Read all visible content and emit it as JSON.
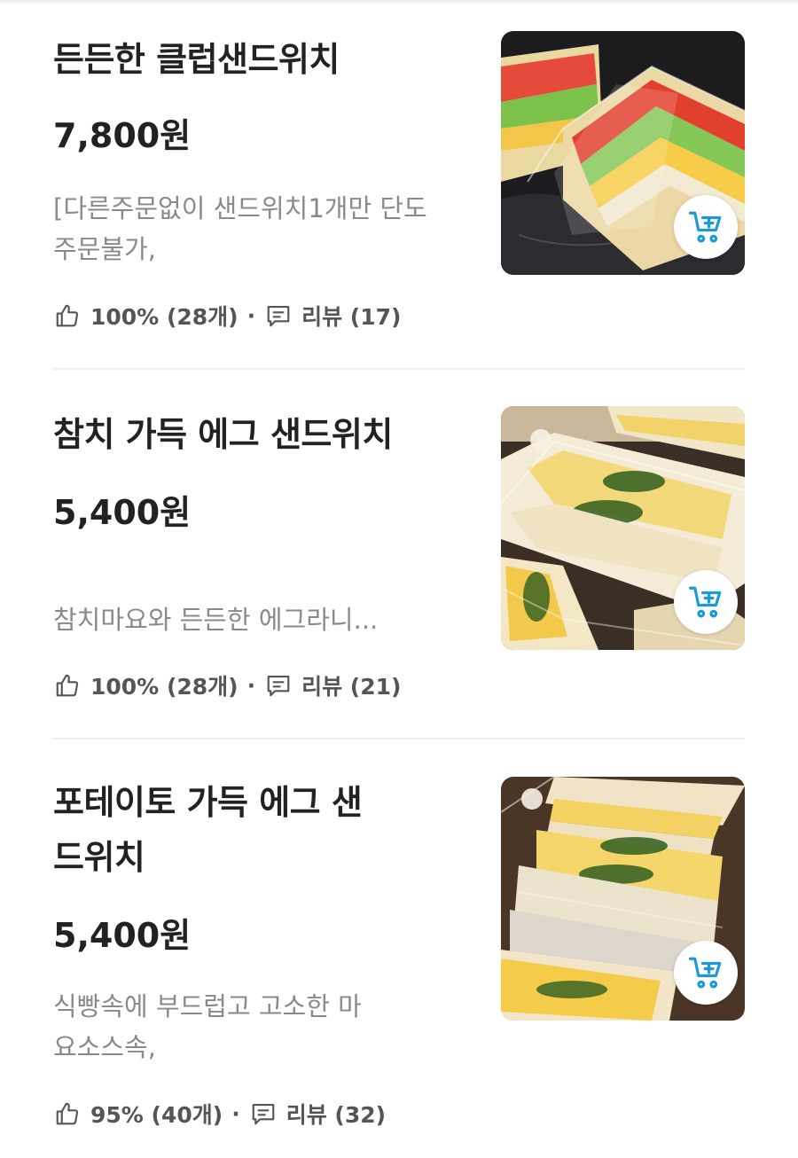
{
  "colors": {
    "accent": "#1a9bd7",
    "text": "#222222",
    "muted": "#8a8a8a",
    "meta": "#555555",
    "divider": "#eeeeee"
  },
  "menu_items": [
    {
      "title": "든든한 클럽샌드위치",
      "price": "7,800원",
      "description": "[다른주문없이 샌드위치1개만 단도주문불가,",
      "rating": "100% (28개)",
      "reviews": "리뷰 (17)",
      "photo": "club-sandwich-photo",
      "cart_icon": "cart-add-icon"
    },
    {
      "title": "참치 가득 에그 샌드위치",
      "price": "5,400원",
      "description": "참치마요와 든든한 에그라니...",
      "rating": "100% (28개)",
      "reviews": "리뷰 (21)",
      "photo": "tuna-egg-sandwich-photo",
      "cart_icon": "cart-add-icon"
    },
    {
      "title": "포테이토 가득 에그 샌드위치",
      "price": "5,400원",
      "description": "식빵속에 부드럽고 고소한 마요소스속,",
      "rating": "95% (40개)",
      "reviews": "리뷰 (32)",
      "photo": "potato-egg-sandwich-photo",
      "cart_icon": "cart-add-icon"
    }
  ]
}
